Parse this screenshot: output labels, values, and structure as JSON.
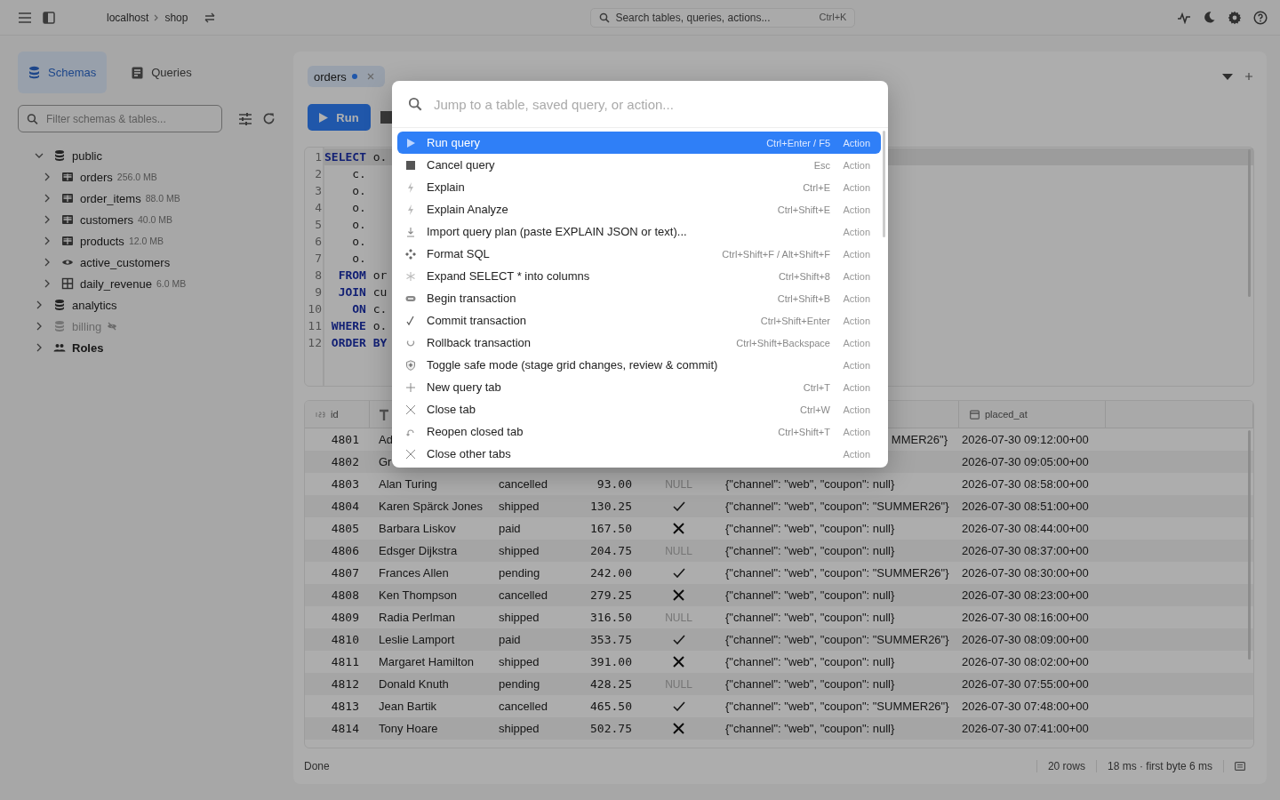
{
  "topbar": {
    "breadcrumb": [
      "localhost",
      "shop"
    ],
    "search": {
      "placeholder": "Search tables, queries, actions...",
      "shortcut": "Ctrl+K"
    }
  },
  "sidebar": {
    "tabs": [
      {
        "label": "Schemas",
        "selected": true
      },
      {
        "label": "Queries",
        "selected": false
      }
    ],
    "filter": {
      "placeholder": "Filter schemas & tables..."
    },
    "tree": [
      {
        "label": "public",
        "kind": "schema",
        "expanded": true,
        "children": [
          {
            "label": "orders",
            "kind": "table",
            "size": "256.0 MB",
            "expanded": false
          },
          {
            "label": "order_items",
            "kind": "table",
            "size": "88.0 MB",
            "expanded": false
          },
          {
            "label": "customers",
            "kind": "table",
            "size": "40.0 MB",
            "expanded": false
          },
          {
            "label": "products",
            "kind": "table",
            "size": "12.0 MB",
            "expanded": false
          },
          {
            "label": "active_customers",
            "kind": "view",
            "expanded": false
          },
          {
            "label": "daily_revenue",
            "kind": "matview",
            "size": "6.0 MB",
            "expanded": false
          }
        ]
      },
      {
        "label": "analytics",
        "kind": "schema",
        "expanded": false
      },
      {
        "label": "billing",
        "kind": "schema",
        "expanded": false,
        "hidden": true
      },
      {
        "label": "Roles",
        "kind": "roles",
        "expanded": false
      }
    ]
  },
  "editor_tabs": [
    {
      "label": "orders",
      "selected": true,
      "modified": true
    }
  ],
  "toolbar": {
    "run": "Run"
  },
  "editor": {
    "lines": [
      {
        "number": "1",
        "current": true,
        "tokens": [
          {
            "text": "SELECT",
            "kind": "keyword"
          },
          {
            "text": "o.",
            "kind": "plain"
          }
        ]
      },
      {
        "number": "2",
        "current": false,
        "tokens": [
          {
            "text": "c.",
            "kind": "plain"
          }
        ]
      },
      {
        "number": "3",
        "current": false,
        "tokens": [
          {
            "text": "o.",
            "kind": "plain"
          }
        ]
      },
      {
        "number": "4",
        "current": false,
        "tokens": [
          {
            "text": "o.",
            "kind": "plain"
          }
        ]
      },
      {
        "number": "5",
        "current": false,
        "tokens": [
          {
            "text": "o.",
            "kind": "plain"
          }
        ]
      },
      {
        "number": "6",
        "current": false,
        "tokens": [
          {
            "text": "o.",
            "kind": "plain"
          }
        ]
      },
      {
        "number": "7",
        "current": false,
        "tokens": [
          {
            "text": "o.",
            "kind": "plain"
          }
        ]
      },
      {
        "number": "8",
        "current": false,
        "tokens": [
          {
            "text": "FROM",
            "kind": "keyword"
          },
          {
            "text": "or",
            "kind": "plain"
          }
        ]
      },
      {
        "number": "9",
        "current": false,
        "tokens": [
          {
            "text": "JOIN",
            "kind": "keyword"
          },
          {
            "text": "cu",
            "kind": "plain"
          }
        ]
      },
      {
        "number": "10",
        "current": false,
        "tokens": [
          {
            "text": "ON",
            "kind": "keyword"
          },
          {
            "text": "c.",
            "kind": "plain"
          }
        ]
      },
      {
        "number": "11",
        "current": false,
        "tokens": [
          {
            "text": "WHERE",
            "kind": "keyword"
          },
          {
            "text": "o.",
            "kind": "plain"
          }
        ]
      },
      {
        "number": "12",
        "current": false,
        "tokens": [
          {
            "text": "ORDER",
            "kind": "keyword"
          },
          {
            "text": "BY",
            "kind": "keyword"
          }
        ]
      }
    ]
  },
  "grid": {
    "columns": [
      {
        "kind": "number",
        "label": "id"
      },
      {
        "kind": "text"
      },
      {
        "kind": "timestamp",
        "label": "placed_at"
      }
    ],
    "rows": [
      {
        "id": "4801",
        "name": "Ad",
        "meta_tail": "MMER26\"}",
        "placed_at": "2026-07-30 09:12:00+00"
      },
      {
        "id": "4802",
        "name": "Gr",
        "placed_at": "2026-07-30 09:05:00+00"
      },
      {
        "id": "4803",
        "name": "Alan Turing",
        "status": "cancelled",
        "total": "93.00",
        "flag": {
          "kind": "null",
          "text": "NULL"
        },
        "meta": "{\"channel\": \"web\", \"coupon\": null}",
        "placed_at": "2026-07-30 08:58:00+00"
      },
      {
        "id": "4804",
        "name": "Karen Spärck Jones",
        "status": "shipped",
        "total": "130.25",
        "flag": {
          "kind": "check"
        },
        "meta": "{\"channel\": \"web\", \"coupon\": \"SUMMER26\"}",
        "placed_at": "2026-07-30 08:51:00+00"
      },
      {
        "id": "4805",
        "name": "Barbara Liskov",
        "status": "paid",
        "total": "167.50",
        "flag": {
          "kind": "cross"
        },
        "meta": "{\"channel\": \"web\", \"coupon\": null}",
        "placed_at": "2026-07-30 08:44:00+00"
      },
      {
        "id": "4806",
        "name": "Edsger Dijkstra",
        "status": "shipped",
        "total": "204.75",
        "flag": {
          "kind": "null",
          "text": "NULL"
        },
        "meta": "{\"channel\": \"web\", \"coupon\": null}",
        "placed_at": "2026-07-30 08:37:00+00"
      },
      {
        "id": "4807",
        "name": "Frances Allen",
        "status": "pending",
        "total": "242.00",
        "flag": {
          "kind": "check"
        },
        "meta": "{\"channel\": \"web\", \"coupon\": \"SUMMER26\"}",
        "placed_at": "2026-07-30 08:30:00+00"
      },
      {
        "id": "4808",
        "name": "Ken Thompson",
        "status": "cancelled",
        "total": "279.25",
        "flag": {
          "kind": "cross"
        },
        "meta": "{\"channel\": \"web\", \"coupon\": null}",
        "placed_at": "2026-07-30 08:23:00+00"
      },
      {
        "id": "4809",
        "name": "Radia Perlman",
        "status": "shipped",
        "total": "316.50",
        "flag": {
          "kind": "null",
          "text": "NULL"
        },
        "meta": "{\"channel\": \"web\", \"coupon\": null}",
        "placed_at": "2026-07-30 08:16:00+00"
      },
      {
        "id": "4810",
        "name": "Leslie Lamport",
        "status": "paid",
        "total": "353.75",
        "flag": {
          "kind": "check"
        },
        "meta": "{\"channel\": \"web\", \"coupon\": \"SUMMER26\"}",
        "placed_at": "2026-07-30 08:09:00+00"
      },
      {
        "id": "4811",
        "name": "Margaret Hamilton",
        "status": "shipped",
        "total": "391.00",
        "flag": {
          "kind": "cross"
        },
        "meta": "{\"channel\": \"web\", \"coupon\": null}",
        "placed_at": "2026-07-30 08:02:00+00"
      },
      {
        "id": "4812",
        "name": "Donald Knuth",
        "status": "pending",
        "total": "428.25",
        "flag": {
          "kind": "null",
          "text": "NULL"
        },
        "meta": "{\"channel\": \"web\", \"coupon\": null}",
        "placed_at": "2026-07-30 07:55:00+00"
      },
      {
        "id": "4813",
        "name": "Jean Bartik",
        "status": "cancelled",
        "total": "465.50",
        "flag": {
          "kind": "check"
        },
        "meta": "{\"channel\": \"web\", \"coupon\": \"SUMMER26\"}",
        "placed_at": "2026-07-30 07:48:00+00"
      },
      {
        "id": "4814",
        "name": "Tony Hoare",
        "status": "shipped",
        "total": "502.75",
        "flag": {
          "kind": "cross"
        },
        "meta": "{\"channel\": \"web\", \"coupon\": null}",
        "placed_at": "2026-07-30 07:41:00+00"
      }
    ]
  },
  "status_bar": {
    "message": "Done",
    "rows": "20 rows",
    "timing": "18 ms · first byte 6 ms"
  },
  "palette": {
    "placeholder": "Jump to a table, saved query, or action...",
    "items": [
      {
        "kind": "play",
        "label": "Run query",
        "shortcut": "Ctrl+Enter / F5",
        "category": "Action",
        "selected": true
      },
      {
        "kind": "stop",
        "label": "Cancel query",
        "shortcut": "Esc",
        "category": "Action",
        "selected": false
      },
      {
        "kind": "bolt",
        "label": "Explain",
        "shortcut": "Ctrl+E",
        "category": "Action",
        "selected": false
      },
      {
        "kind": "bolt",
        "label": "Explain Analyze",
        "shortcut": "Ctrl+Shift+E",
        "category": "Action",
        "selected": false
      },
      {
        "kind": "import",
        "label": "Import query plan (paste EXPLAIN JSON or text)...",
        "category": "Action",
        "selected": false
      },
      {
        "kind": "format",
        "label": "Format SQL",
        "shortcut": "Ctrl+Shift+F / Alt+Shift+F",
        "category": "Action",
        "selected": false
      },
      {
        "kind": "asterisk",
        "label": "Expand SELECT * into columns",
        "shortcut": "Ctrl+Shift+8",
        "category": "Action",
        "selected": false
      },
      {
        "kind": "begin",
        "label": "Begin transaction",
        "shortcut": "Ctrl+Shift+B",
        "category": "Action",
        "selected": false
      },
      {
        "kind": "check",
        "label": "Commit transaction",
        "shortcut": "Ctrl+Shift+Enter",
        "category": "Action",
        "selected": false
      },
      {
        "kind": "rollback",
        "label": "Rollback transaction",
        "shortcut": "Ctrl+Shift+Backspace",
        "category": "Action",
        "selected": false
      },
      {
        "kind": "shield",
        "label": "Toggle safe mode (stage grid changes, review & commit)",
        "category": "Action",
        "selected": false
      },
      {
        "kind": "plus",
        "label": "New query tab",
        "shortcut": "Ctrl+T",
        "category": "Action",
        "selected": false
      },
      {
        "kind": "close",
        "label": "Close tab",
        "shortcut": "Ctrl+W",
        "category": "Action",
        "selected": false
      },
      {
        "kind": "reopen",
        "label": "Reopen closed tab",
        "shortcut": "Ctrl+Shift+T",
        "category": "Action",
        "selected": false
      },
      {
        "kind": "close",
        "label": "Close other tabs",
        "category": "Action",
        "selected": false
      }
    ]
  }
}
